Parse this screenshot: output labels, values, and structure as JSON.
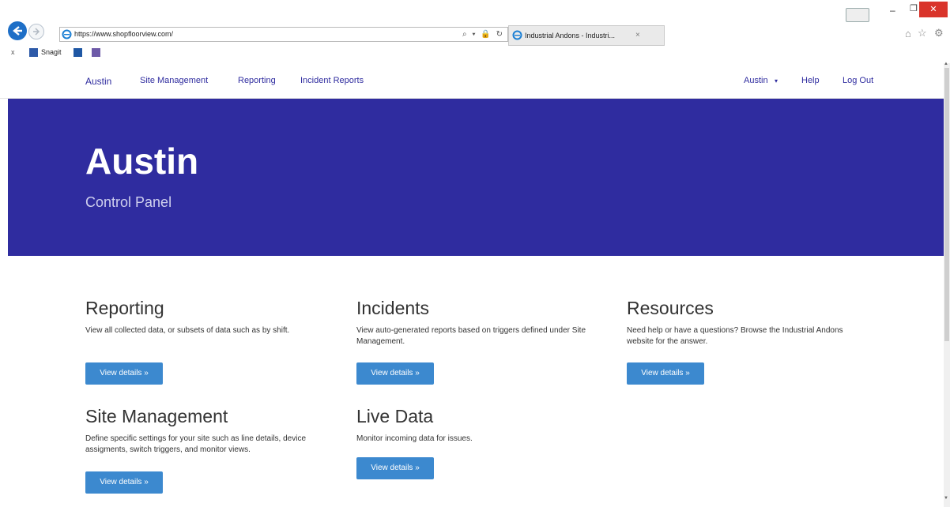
{
  "browser": {
    "url": "https://www.shopfloorview.com/",
    "tab_title": "Industrial Andons - Industri...",
    "tab_close": "×",
    "addr_tools": "⌕ ▾ 🔒 ↻",
    "favorites": [
      {
        "label": "Snagit"
      }
    ],
    "close_fav_bar": "x"
  },
  "nav": {
    "brand": "Austin",
    "links": [
      "Site Management",
      "Reporting",
      "Incident Reports"
    ],
    "user": "Austin",
    "user_caret": "▾",
    "help": "Help",
    "logout": "Log Out"
  },
  "hero": {
    "title": "Austin",
    "subtitle": "Control Panel",
    "background_color": "#2f2c9f"
  },
  "cards": [
    {
      "title": "Reporting",
      "text": "View all collected data, or subsets of data such as by shift.",
      "button": "View details »"
    },
    {
      "title": "Incidents",
      "text": "View auto-generated reports based on triggers defined under Site Management.",
      "button": "View details »"
    },
    {
      "title": "Resources",
      "text": "Need help or have a questions? Browse the Industrial Andons website for the answer.",
      "button": "View details »"
    },
    {
      "title": "Site Management",
      "text": "Define specific settings for your site such as line details, device assigments, switch triggers, and monitor views.",
      "button": "View details »"
    },
    {
      "title": "Live Data",
      "text": "Monitor incoming data for issues.",
      "button": "View details »"
    }
  ],
  "colors": {
    "accent": "#2f2c9f",
    "button": "#3c89cf"
  }
}
